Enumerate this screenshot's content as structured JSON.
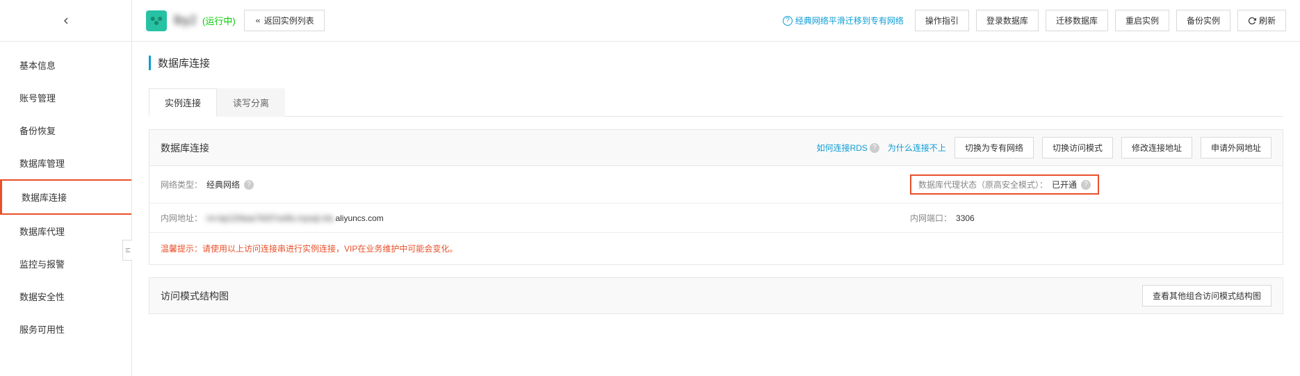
{
  "sidebar": {
    "items": [
      "基本信息",
      "账号管理",
      "备份恢复",
      "数据库管理",
      "数据库连接",
      "数据库代理",
      "监控与报警",
      "数据安全性",
      "服务可用性"
    ],
    "activeIndex": 4
  },
  "header": {
    "instanceName": "lby2",
    "status": "(运行中)",
    "returnButton": "返回实例列表",
    "migrateLink": "经典网络平滑迁移到专有网络",
    "buttons": {
      "guide": "操作指引",
      "login": "登录数据库",
      "migrate": "迁移数据库",
      "restart": "重启实例",
      "backup": "备份实例",
      "refresh": "刷新"
    }
  },
  "page": {
    "title": "数据库连接",
    "tabs": {
      "instance": "实例连接",
      "readwrite": "读写分离"
    }
  },
  "connectionPanel": {
    "title": "数据库连接",
    "links": {
      "howToConnect": "如何连接RDS",
      "whyCantConnect": "为什么连接不上"
    },
    "buttons": {
      "switchVpc": "切换为专有网络",
      "switchMode": "切换访问模式",
      "modifyAddress": "修改连接地址",
      "applyPublic": "申请外网地址"
    },
    "networkType": {
      "label": "网络类型：",
      "value": "经典网络"
    },
    "proxyStatus": {
      "label": "数据库代理状态（原高安全模式）：",
      "value": "已开通"
    },
    "intranetAddr": {
      "label": "内网地址：",
      "valuePrefix": "rm-bp12hkae7k0t7vw9s.mysql.rds.",
      "valueSuffix": "aliyuncs.com"
    },
    "intranetPort": {
      "label": "内网端口：",
      "value": "3306"
    },
    "warning": "温馨提示：请使用以上访问连接串进行实例连接，VIP在业务维护中可能会变化。"
  },
  "accessPanel": {
    "title": "访问模式结构图",
    "button": "查看其他组合访问模式结构图"
  }
}
